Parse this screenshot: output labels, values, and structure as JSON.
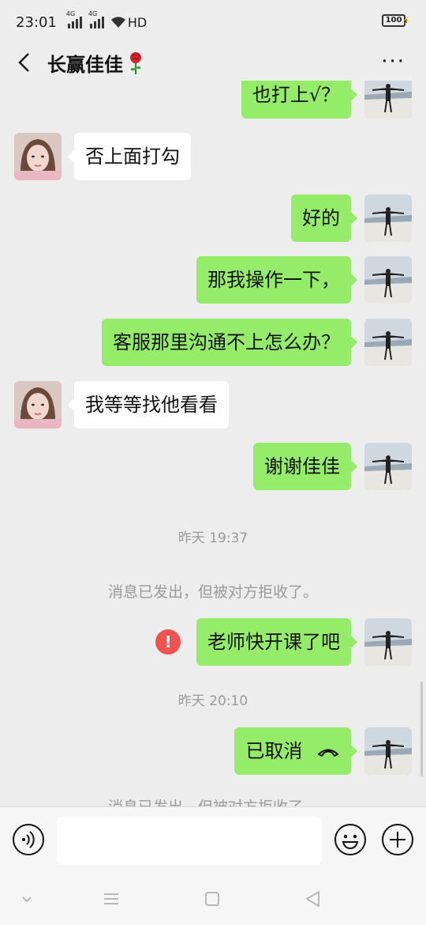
{
  "status_bar": {
    "time": "23:01",
    "network_1": "4G",
    "network_2": "4G",
    "hd": "HD",
    "battery": "100"
  },
  "header": {
    "title": "长赢佳佳",
    "back_icon": "chevron-left-icon",
    "more_icon": "more-dots-icon"
  },
  "messages": [
    {
      "side": "right",
      "text": "也打上√？"
    },
    {
      "side": "left",
      "text": "否上面打勾"
    },
    {
      "side": "right",
      "text": "好的"
    },
    {
      "side": "right",
      "text": "那我操作一下，"
    },
    {
      "side": "right",
      "text": "客服那里沟通不上怎么办？"
    },
    {
      "side": "left",
      "text": "我等等找他看看"
    },
    {
      "side": "right",
      "text": "谢谢佳佳"
    },
    {
      "type": "time",
      "text": "昨天 19:37"
    },
    {
      "type": "system",
      "text": "消息已发出，但被对方拒收了。"
    },
    {
      "side": "right",
      "text": "老师快开课了吧",
      "failed": true
    },
    {
      "type": "time",
      "text": "昨天 20:10"
    },
    {
      "side": "right",
      "text": "已取消",
      "call": "cancelled-call-icon"
    },
    {
      "type": "system",
      "text": "消息已发出，但被对方拒收了。"
    }
  ],
  "error_mark": "!",
  "input_bar": {
    "voice_icon": "voice-icon",
    "emoji_icon": "emoji-icon",
    "plus_icon": "plus-icon"
  },
  "colors": {
    "background": "#ededed",
    "bubble_self": "#95ec69",
    "bubble_other": "#ffffff",
    "error": "#f05252"
  }
}
